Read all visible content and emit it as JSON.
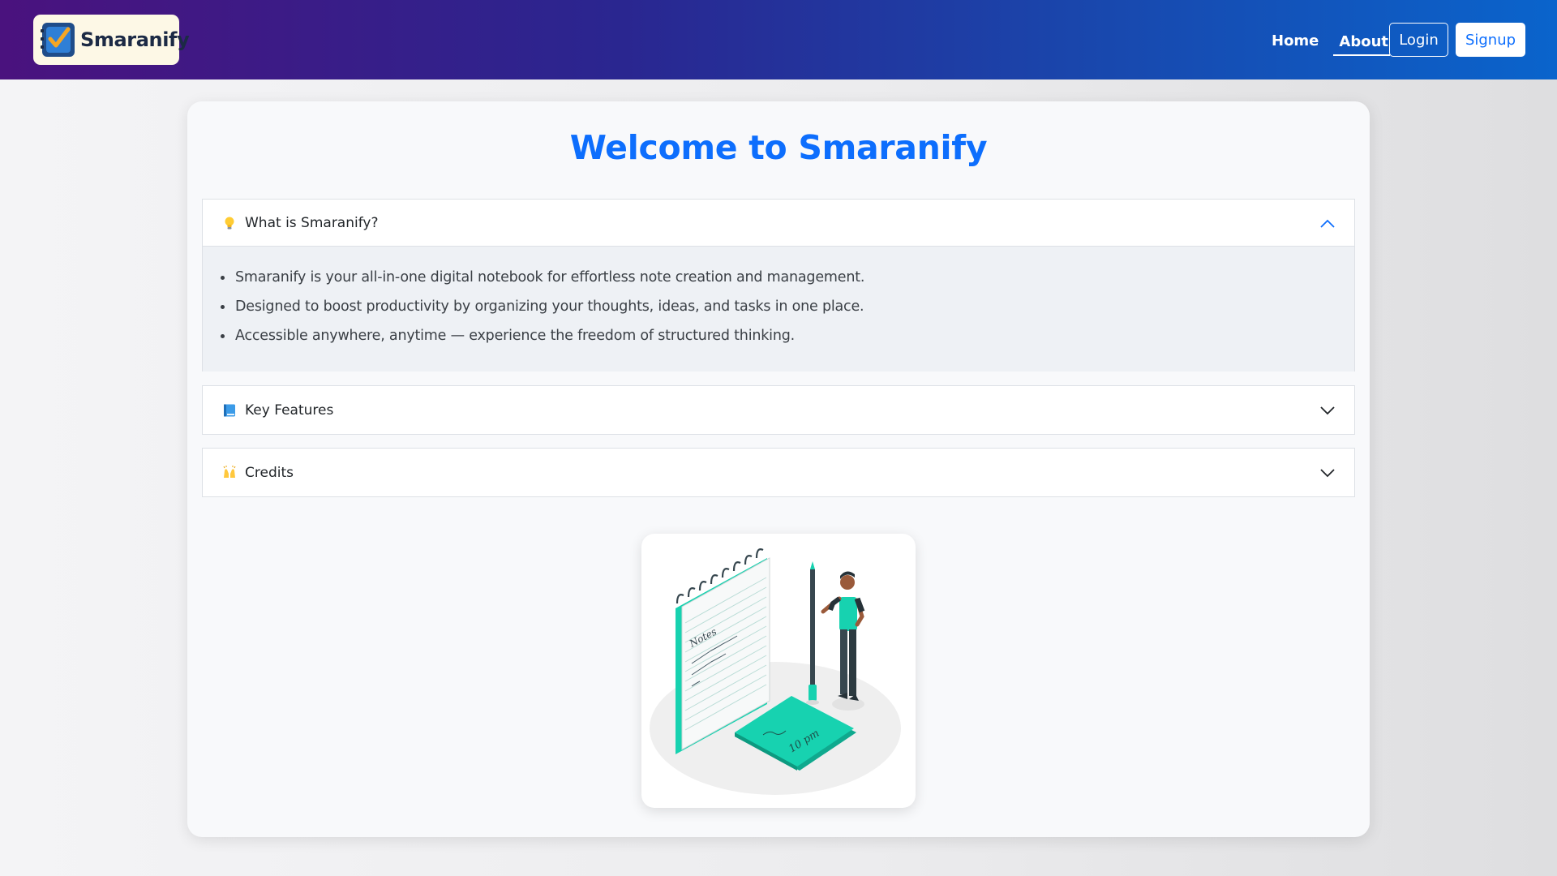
{
  "navbar": {
    "brand": "Smaranify",
    "links": [
      "Home",
      "About"
    ],
    "login_label": "Login",
    "signup_label": "Signup"
  },
  "page": {
    "title": "Welcome to Smaranify"
  },
  "accordion": [
    {
      "icon": "lightbulb-icon",
      "label": "What is Smaranify?",
      "expanded": true,
      "items": [
        "Smaranify is your all-in-one digital notebook for effortless note creation and management.",
        "Designed to boost productivity by organizing your thoughts, ideas, and tasks in one place.",
        "Accessible anywhere, anytime — experience the freedom of structured thinking."
      ]
    },
    {
      "icon": "blue-book-icon",
      "label": "Key Features",
      "expanded": false
    },
    {
      "icon": "raising-hands-icon",
      "label": "Credits",
      "expanded": false
    }
  ],
  "illustration": {
    "notebook_text": "Notes",
    "sticky_text": "10 pm"
  },
  "colors": {
    "accent": "#0d6efd",
    "illustration_teal": "#17d2b0"
  }
}
